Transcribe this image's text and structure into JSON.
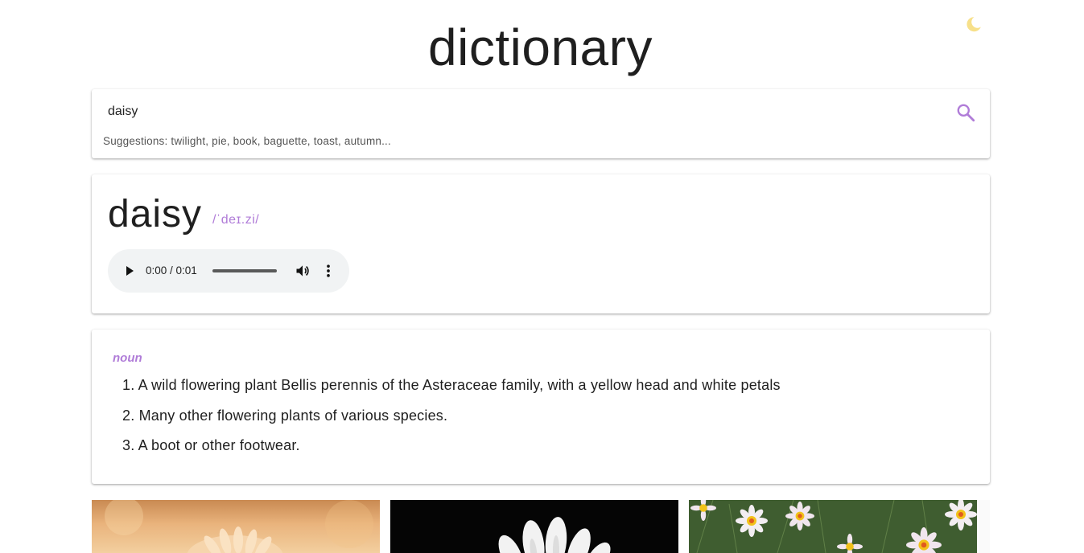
{
  "app": {
    "title": "dictionary",
    "theme_icon": "moon-icon",
    "colors": {
      "accent": "#b07cd8",
      "moon": "#f7e08a"
    }
  },
  "search": {
    "value": "daisy",
    "placeholder": "",
    "button_icon": "search-icon",
    "suggestions": "Suggestions: twilight, pie, book, baguette, toast, autumn..."
  },
  "entry": {
    "word": "daisy",
    "phonetic": "/ˈdeɪ.zi/",
    "audio": {
      "time": "0:00 / 0:01",
      "progress": 0,
      "play_icon": "play-icon",
      "volume_icon": "volume-icon",
      "more_icon": "more-vert-icon"
    }
  },
  "meanings": [
    {
      "part_of_speech": "noun",
      "definitions": [
        "1. A wild flowering plant Bellis perennis of the Asteraceae family, with a yellow head and white petals",
        "2. Many other flowering plants of various species.",
        "3. A boot or other footwear."
      ]
    }
  ],
  "images": [
    {
      "name": "daisy-photo-1"
    },
    {
      "name": "daisy-photo-2"
    },
    {
      "name": "daisy-photo-3"
    }
  ]
}
